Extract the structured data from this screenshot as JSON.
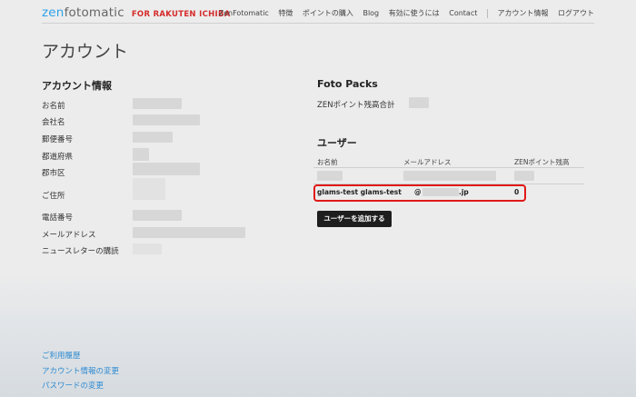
{
  "header": {
    "logo_zen": "zen",
    "logo_foto": "fotomatic",
    "logo_rakuten": "FOR RAKUTEN ICHIBA",
    "nav": [
      "ZenFotomatic",
      "特徴",
      "ポイントの購入",
      "Blog",
      "有効に使うには",
      "Contact"
    ],
    "account_nav": [
      "アカウント情報",
      "ログアウト"
    ]
  },
  "page_title": "アカウント",
  "account": {
    "title": "アカウント情報",
    "labels": [
      "お名前",
      "会社名",
      "郵便番号",
      "都道府県",
      "郡市区",
      "ご住所",
      "電話番号",
      "メールアドレス",
      "ニュースレターの購読"
    ]
  },
  "foto_packs": {
    "title": "Foto Packs",
    "points_label": "ZENポイント残高合計"
  },
  "users": {
    "title": "ユーザー",
    "columns": [
      "お名前",
      "メールアドレス",
      "ZENポイント残高"
    ],
    "highlighted_row": {
      "name": "glams-test glams-test",
      "email_at": "@",
      "email_tld": ".jp",
      "points": "0"
    },
    "add_button": "ユーザーを追加する"
  },
  "footer": {
    "links": [
      "ご利用履歴",
      "アカウント情報の変更",
      "パスワードの変更"
    ]
  },
  "colors": {
    "accent": "#2ea0e8",
    "brand_red": "#d62b2b",
    "highlight": "#e01818",
    "link": "#2d8ad1"
  }
}
